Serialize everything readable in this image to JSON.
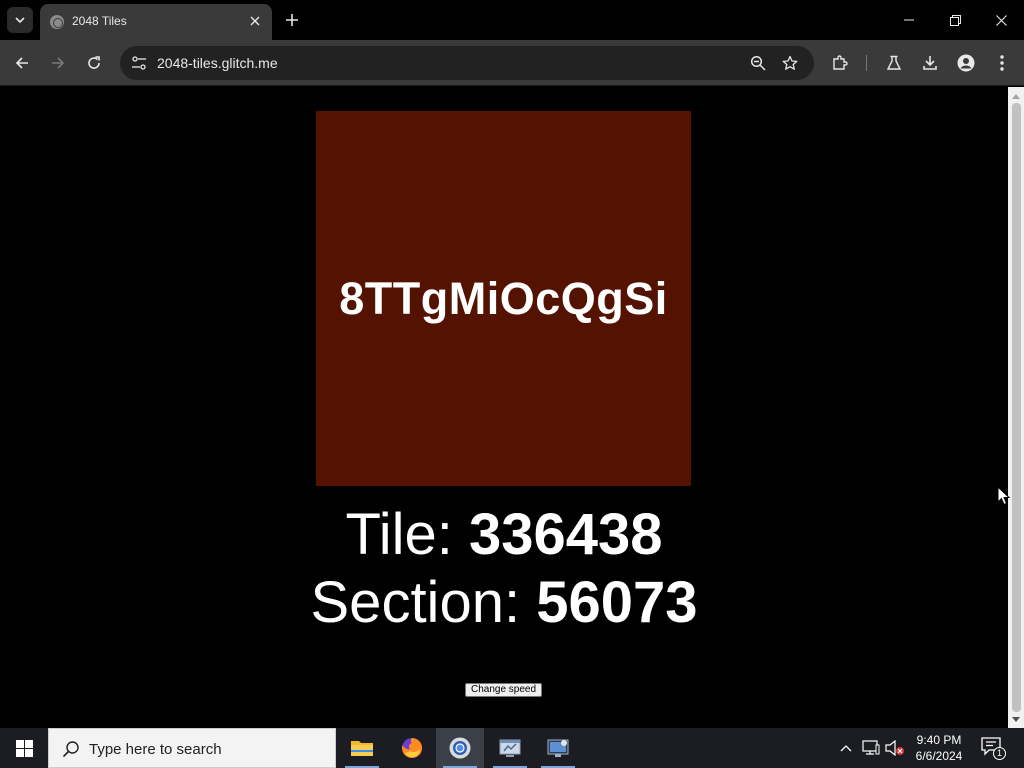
{
  "browser": {
    "tab": {
      "title": "2048 Tiles"
    },
    "address": {
      "url": "2048-tiles.glitch.me"
    }
  },
  "page": {
    "tile": {
      "text": "8TTgMiOcQgSi",
      "color": "#541300"
    },
    "tile_line": {
      "label": "Tile: ",
      "value": "336438"
    },
    "section_line": {
      "label": "Section: ",
      "value": "56073"
    },
    "change_speed_label": "Change speed"
  },
  "taskbar": {
    "search_placeholder": "Type here to search",
    "clock": {
      "time": "9:40 PM",
      "date": "6/6/2024"
    },
    "notification_count": "1",
    "apps": [
      "file-explorer",
      "firefox",
      "chrome",
      "network-app",
      "remote-desktop"
    ]
  },
  "colors": {
    "page_bg": "#000000",
    "chrome_bg": "#3a3a3a",
    "taskbar_bg": "#1b1d22"
  }
}
